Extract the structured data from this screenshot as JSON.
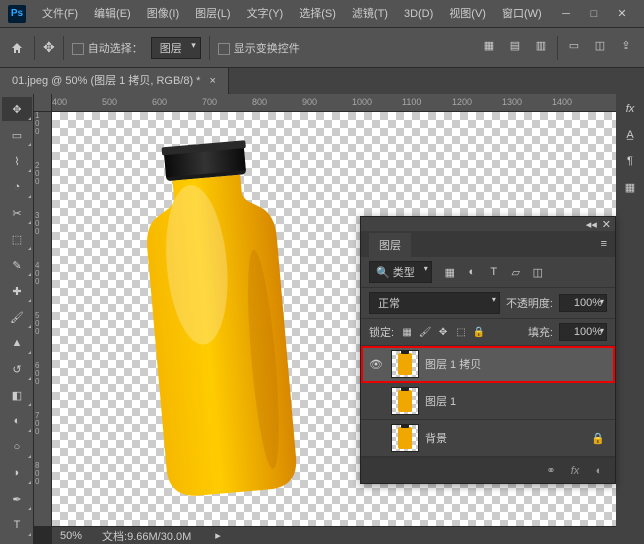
{
  "menu": [
    "文件(F)",
    "编辑(E)",
    "图像(I)",
    "图层(L)",
    "文字(Y)",
    "选择(S)",
    "滤镜(T)",
    "3D(D)",
    "视图(V)",
    "窗口(W)"
  ],
  "options": {
    "auto_select": "自动选择：",
    "target": "图层",
    "show_transform": "显示变换控件"
  },
  "doc_tab": "01.jpeg @ 50% (图层 1 拷贝, RGB/8) *",
  "ruler_top": [
    "400",
    "500",
    "600",
    "700",
    "800",
    "900",
    "1000",
    "1100",
    "1200",
    "1300",
    "1400"
  ],
  "ruler_left": [
    "100",
    "200",
    "300",
    "400",
    "500",
    "600",
    "700",
    "800"
  ],
  "status": {
    "zoom": "50%",
    "doc": "文档:9.66M/30.0M"
  },
  "layers_panel": {
    "title": "图层",
    "filter_label": "类型",
    "blend_mode": "正常",
    "opacity_label": "不透明度:",
    "opacity_value": "100%",
    "lock_label": "锁定:",
    "fill_label": "填充:",
    "fill_value": "100%",
    "layers": [
      {
        "name": "图层 1 拷贝",
        "visible": true,
        "selected": true,
        "locked": false
      },
      {
        "name": "图层 1",
        "visible": false,
        "selected": false,
        "locked": false
      },
      {
        "name": "背景",
        "visible": false,
        "selected": false,
        "locked": true
      }
    ]
  }
}
